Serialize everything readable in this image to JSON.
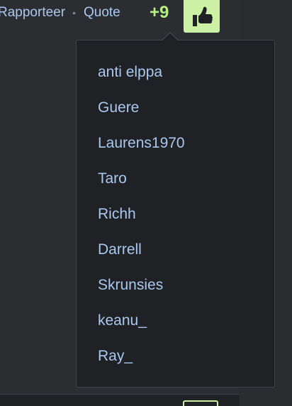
{
  "post_actions": {
    "report_label": "Rapporteer",
    "separator": "•",
    "quote_label": "Quote"
  },
  "reactions": {
    "count": "+9",
    "like_icon": "thumbs-up-icon",
    "accent_color": "#ccf0a4"
  },
  "likers_popup": {
    "users": [
      "anti elppa",
      "Guere",
      "Laurens1970",
      "Taro",
      "Richh",
      "Darrell",
      "Skrunsies",
      "keanu_",
      "Ray_"
    ]
  }
}
